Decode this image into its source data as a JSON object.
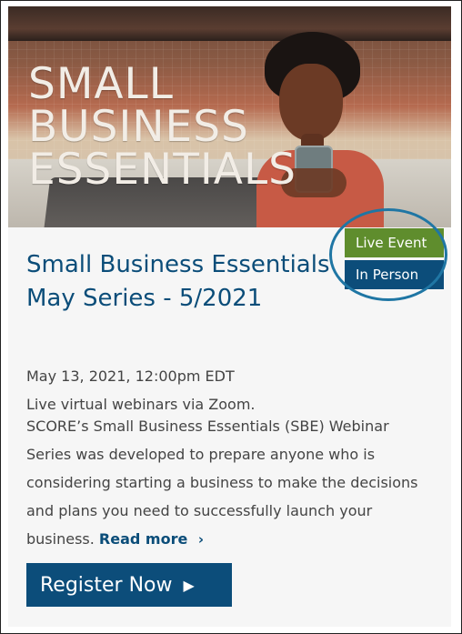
{
  "hero": {
    "title_lines": [
      "SMALL",
      "BUSINESS",
      "ESSENTIALS"
    ]
  },
  "badges": {
    "live": "Live Event",
    "in_person": "In Person"
  },
  "event": {
    "title": "Small Business Essentials May Series - 5/2021",
    "datetime": "May 13, 2021, 12:00pm EDT",
    "format": "Live virtual webinars via Zoom.",
    "description": "SCORE’s Small Business Essentials (SBE) Webinar Series was developed to prepare anyone who is considering starting a business to make the decisions and plans you need to successfully launch your business.",
    "read_more": "Read more",
    "register": "Register Now"
  },
  "icons": {
    "read_more": "chevron-right-icon",
    "register": "caret-right-icon"
  },
  "colors": {
    "brand_blue": "#0c4d7a",
    "live_green": "#5f8d2d",
    "highlight_circle": "#1f76a4"
  }
}
